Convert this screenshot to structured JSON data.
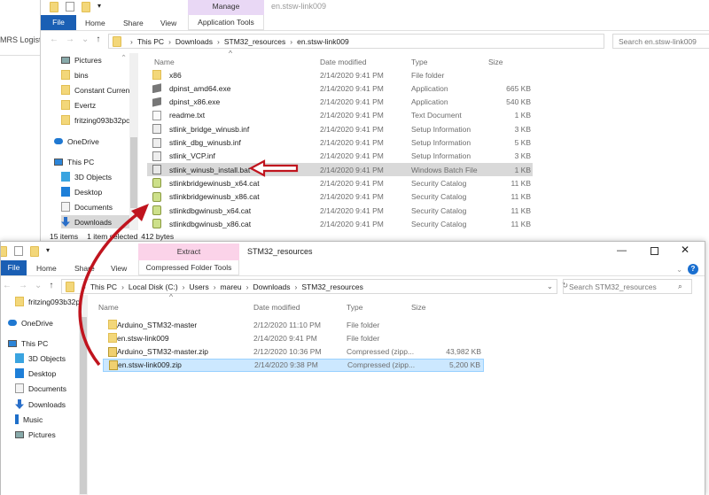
{
  "background_window": {
    "title_fragment": "MRS Logist"
  },
  "top_window": {
    "title": "en.stsw-link009",
    "context_tab": "Manage",
    "tabs": [
      "File",
      "Home",
      "Share",
      "View",
      "Application Tools"
    ],
    "breadcrumb": [
      "This PC",
      "Downloads",
      "STM32_resources",
      "en.stsw-link009"
    ],
    "search_placeholder": "Search en.stsw-link009",
    "nav": [
      {
        "label": "Pictures",
        "icon": "pictures-icon"
      },
      {
        "label": "bins",
        "icon": "folder-icon"
      },
      {
        "label": "Constant Curren",
        "icon": "folder-icon"
      },
      {
        "label": "Evertz",
        "icon": "folder-icon"
      },
      {
        "label": "fritzing093b32pc",
        "icon": "folder-icon"
      },
      {
        "label": "OneDrive",
        "icon": "cloud-icon"
      },
      {
        "label": "This PC",
        "icon": "computer-icon"
      },
      {
        "label": "3D Objects",
        "icon": "cube-icon"
      },
      {
        "label": "Desktop",
        "icon": "desktop-icon"
      },
      {
        "label": "Documents",
        "icon": "document-icon"
      },
      {
        "label": "Downloads",
        "icon": "download-icon"
      }
    ],
    "columns": [
      "Name",
      "Date modified",
      "Type",
      "Size"
    ],
    "files": [
      {
        "name": "x86",
        "date": "2/14/2020 9:41 PM",
        "type": "File folder",
        "size": "",
        "icon": "folder-icon"
      },
      {
        "name": "dpinst_amd64.exe",
        "date": "2/14/2020 9:41 PM",
        "type": "Application",
        "size": "665 KB",
        "icon": "exe-icon"
      },
      {
        "name": "dpinst_x86.exe",
        "date": "2/14/2020 9:41 PM",
        "type": "Application",
        "size": "540 KB",
        "icon": "exe-icon"
      },
      {
        "name": "readme.txt",
        "date": "2/14/2020 9:41 PM",
        "type": "Text Document",
        "size": "1 KB",
        "icon": "text-file-icon"
      },
      {
        "name": "stlink_bridge_winusb.inf",
        "date": "2/14/2020 9:41 PM",
        "type": "Setup Information",
        "size": "3 KB",
        "icon": "inf-file-icon"
      },
      {
        "name": "stlink_dbg_winusb.inf",
        "date": "2/14/2020 9:41 PM",
        "type": "Setup Information",
        "size": "5 KB",
        "icon": "inf-file-icon"
      },
      {
        "name": "stlink_VCP.inf",
        "date": "2/14/2020 9:41 PM",
        "type": "Setup Information",
        "size": "3 KB",
        "icon": "inf-file-icon"
      },
      {
        "name": "stlink_winusb_install.bat",
        "date": "2/14/2020 9:41 PM",
        "type": "Windows Batch File",
        "size": "1 KB",
        "icon": "batch-file-icon"
      },
      {
        "name": "stlinkbridgewinusb_x64.cat",
        "date": "2/14/2020 9:41 PM",
        "type": "Security Catalog",
        "size": "11 KB",
        "icon": "catalog-icon"
      },
      {
        "name": "stlinkbridgewinusb_x86.cat",
        "date": "2/14/2020 9:41 PM",
        "type": "Security Catalog",
        "size": "11 KB",
        "icon": "catalog-icon"
      },
      {
        "name": "stlinkdbgwinusb_x64.cat",
        "date": "2/14/2020 9:41 PM",
        "type": "Security Catalog",
        "size": "11 KB",
        "icon": "catalog-icon"
      },
      {
        "name": "stlinkdbgwinusb_x86.cat",
        "date": "2/14/2020 9:41 PM",
        "type": "Security Catalog",
        "size": "11 KB",
        "icon": "catalog-icon"
      }
    ],
    "selected_index": 7,
    "status": {
      "count": "15 items",
      "selected": "1 item selected",
      "size": "412 bytes"
    }
  },
  "bottom_window": {
    "title": "STM32_resources",
    "context_tab": "Extract",
    "tabs": [
      "File",
      "Home",
      "Share",
      "View",
      "Compressed Folder Tools"
    ],
    "breadcrumb": [
      "This PC",
      "Local Disk (C:)",
      "Users",
      "mareu",
      "Downloads",
      "STM32_resources"
    ],
    "search_placeholder": "Search STM32_resources",
    "nav": [
      {
        "label": "fritzing093b32pc",
        "icon": "folder-icon"
      },
      {
        "label": "OneDrive",
        "icon": "cloud-icon"
      },
      {
        "label": "This PC",
        "icon": "computer-icon"
      },
      {
        "label": "3D Objects",
        "icon": "cube-icon"
      },
      {
        "label": "Desktop",
        "icon": "desktop-icon"
      },
      {
        "label": "Documents",
        "icon": "document-icon"
      },
      {
        "label": "Downloads",
        "icon": "download-icon"
      },
      {
        "label": "Music",
        "icon": "music-icon"
      },
      {
        "label": "Pictures",
        "icon": "pictures-icon"
      }
    ],
    "columns": [
      "Name",
      "Date modified",
      "Type",
      "Size"
    ],
    "files": [
      {
        "name": "Arduino_STM32-master",
        "date": "2/12/2020 11:10 PM",
        "type": "File folder",
        "size": "",
        "icon": "folder-icon"
      },
      {
        "name": "en.stsw-link009",
        "date": "2/14/2020 9:41 PM",
        "type": "File folder",
        "size": "",
        "icon": "folder-icon"
      },
      {
        "name": "Arduino_STM32-master.zip",
        "date": "2/12/2020 10:36 PM",
        "type": "Compressed (zipp...",
        "size": "43,982 KB",
        "icon": "zip-icon"
      },
      {
        "name": "en.stsw-link009.zip",
        "date": "2/14/2020 9:38 PM",
        "type": "Compressed (zipp...",
        "size": "5,200 KB",
        "icon": "zip-icon"
      }
    ],
    "selected_index": 3
  },
  "colors": {
    "file_tab": "#1a5fb4",
    "manage_tab": "#e9d8f5",
    "extract_tab": "#fbd3e9",
    "selected_gray": "#d9d9d9",
    "selected_blue": "#cce8ff",
    "arrow": "#c0141e"
  }
}
